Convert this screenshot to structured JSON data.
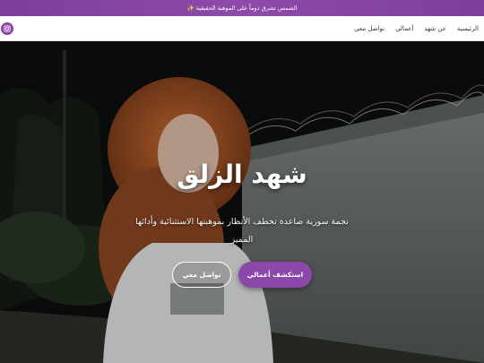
{
  "announcement": "الشمس تشرق دوماً على الموهبة الحقيقية ✨",
  "nav": {
    "items": [
      {
        "label": "الرئيسية"
      },
      {
        "label": "عن شهد"
      },
      {
        "label": "أعمالي"
      },
      {
        "label": "تواصل معي"
      }
    ],
    "social_icon": "instagram-icon"
  },
  "hero": {
    "title": "شهد الزلق",
    "subtitle": "نجمة سورية صاعدة تخطف الأنظار بموهبتها الاستثنائية وأدائها المميز",
    "primary_button": "استكشف أعمالي",
    "secondary_button": "تواصل معي"
  },
  "colors": {
    "accent": "#8c48a9",
    "topbar": "#7d3f9c"
  }
}
